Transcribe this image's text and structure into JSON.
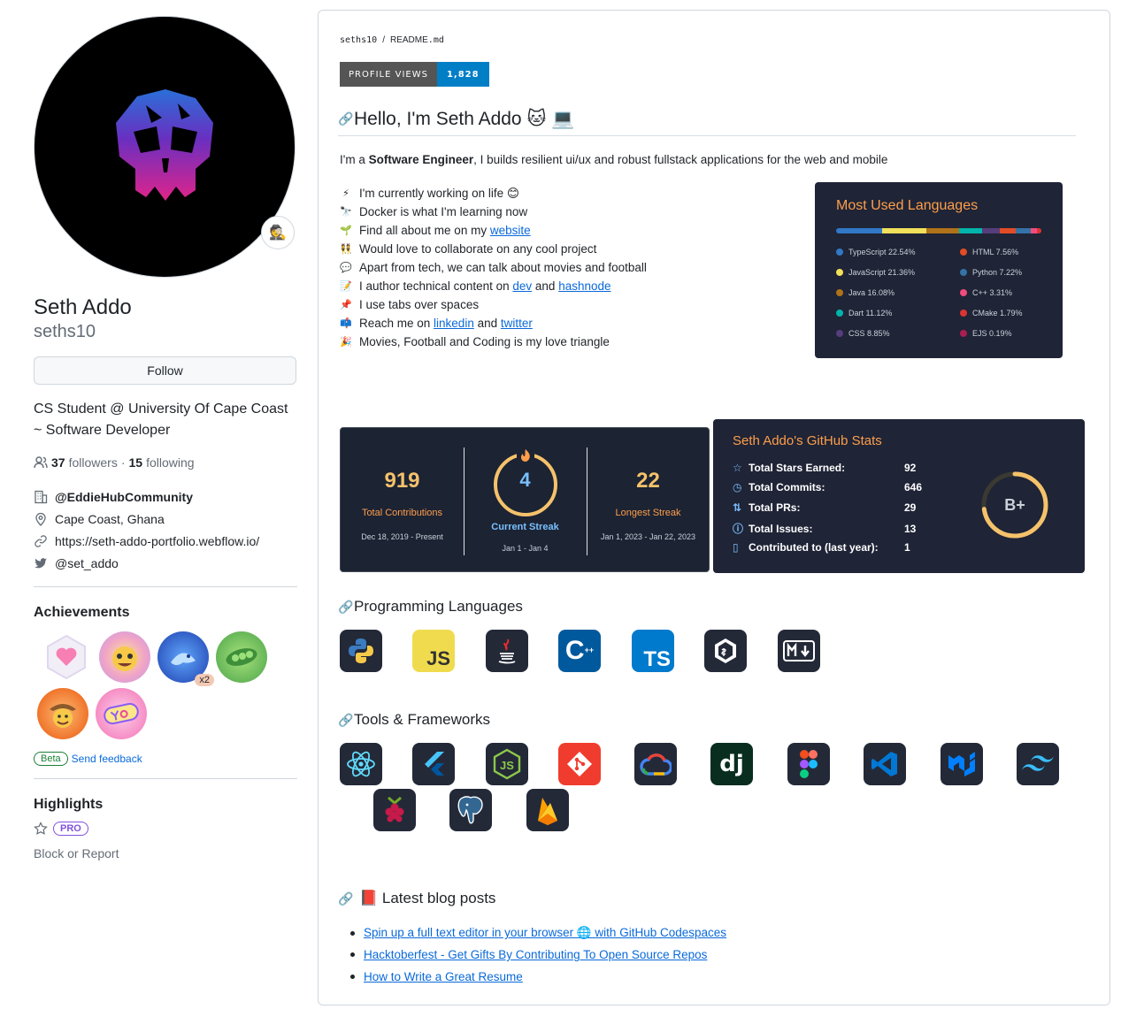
{
  "profile": {
    "fullname": "Seth Addo",
    "username": "seths10",
    "follow_label": "Follow",
    "bio": "CS Student @ University Of Cape Coast ~ Software Developer",
    "followers_count": "37",
    "followers_label": "followers",
    "dot": "·",
    "following_count": "15",
    "following_label": "following",
    "organization": "@EddieHubCommunity",
    "location": "Cape Coast, Ghana",
    "website": "https://seth-addo-portfolio.webflow.io/",
    "twitter": "@set_addo",
    "status_emoji": "🕵️"
  },
  "achievements": {
    "title": "Achievements",
    "badge_x2": "x2",
    "beta": "Beta",
    "feedback": "Send feedback"
  },
  "highlights": {
    "title": "Highlights",
    "pro": "PRO",
    "block": "Block or Report"
  },
  "readme": {
    "crumb_user": "seths10",
    "crumb_sep": "/",
    "crumb_file": "README",
    "crumb_ext": ".md",
    "views_label": "PROFILE VIEWS",
    "views_value": "1,828",
    "heading": "Hello, I'm Seth Addo 🐱 💻",
    "intro_pre": "I'm a ",
    "intro_bold": "Software Engineer",
    "intro_post": ", I builds resilient ui/ux and robust fullstack applications for the web and mobile",
    "facts": [
      {
        "icon": "⚡",
        "text": "I'm currently working on life 😊"
      },
      {
        "icon": "🔭",
        "text": "Docker is what I'm learning now"
      },
      {
        "icon": "🌱",
        "pre": "Find all about me on my ",
        "link": "website"
      },
      {
        "icon": "👯",
        "text": "Would love to collaborate on any cool project"
      },
      {
        "icon": "💬",
        "text": "Apart from tech, we can talk about movies and football"
      },
      {
        "icon": "📝",
        "pre": "I author technical content on ",
        "link": "dev",
        "mid": " and ",
        "link2": "hashnode"
      },
      {
        "icon": "📌",
        "text": "I use tabs over spaces"
      },
      {
        "icon": "📫",
        "pre": "Reach me on ",
        "link": "linkedin",
        "mid": " and ",
        "link2": "twitter"
      },
      {
        "icon": "🎉",
        "text": "Movies, Football and Coding is my love triangle"
      }
    ],
    "prog_heading": "Programming Languages",
    "tools_heading": "Tools & Frameworks",
    "blog_heading": "📕 Latest blog posts",
    "blog_posts": [
      {
        "a": "Spin up a full text editor in your browser 🌐 with GitHub Codespaces"
      },
      {
        "a": "Hacktoberfest - Get Gifts By Contributing To Open Source Repos"
      },
      {
        "a": "How to Write a Great Resume"
      }
    ]
  },
  "langs": {
    "title": "Most Used Languages",
    "items": [
      {
        "name": "TypeScript 22.54%",
        "color": "#3178c6"
      },
      {
        "name": "JavaScript 21.36%",
        "color": "#f1e05a"
      },
      {
        "name": "Java 16.08%",
        "color": "#b07219"
      },
      {
        "name": "Dart 11.12%",
        "color": "#00b4ab"
      },
      {
        "name": "CSS 8.85%",
        "color": "#563d7c"
      },
      {
        "name": "HTML 7.56%",
        "color": "#e34c26"
      },
      {
        "name": "Python 7.22%",
        "color": "#3572a5"
      },
      {
        "name": "C++ 3.31%",
        "color": "#f34b7d"
      },
      {
        "name": "CMake 1.79%",
        "color": "#da3434"
      },
      {
        "name": "EJS 0.19%",
        "color": "#a91e50"
      }
    ]
  },
  "streak": {
    "total": "919",
    "total_label": "Total Contributions",
    "total_range": "Dec 18, 2019 - Present",
    "current": "4",
    "current_label": "Current Streak",
    "current_range": "Jan 1 - Jan 4",
    "longest": "22",
    "longest_label": "Longest Streak",
    "longest_range": "Jan 1, 2023 - Jan 22, 2023"
  },
  "stats": {
    "title": "Seth Addo's GitHub Stats",
    "rows": [
      {
        "label": "Total Stars Earned:",
        "value": "92",
        "icon": "☆"
      },
      {
        "label": "Total Commits:",
        "value": "646",
        "icon": "◷"
      },
      {
        "label": "Total PRs:",
        "value": "29",
        "icon": "⇅"
      },
      {
        "label": "Total Issues:",
        "value": "13",
        "icon": "ⓘ"
      },
      {
        "label": "Contributed to (last year):",
        "value": "1",
        "icon": "▯"
      }
    ],
    "grade": "B+"
  },
  "prog_icons": [
    "python-icon",
    "javascript-icon",
    "java-icon",
    "cplusplus-icon",
    "typescript-icon",
    "bash-icon",
    "markdown-icon"
  ],
  "tool_icons": [
    "react-icon",
    "flutter-icon",
    "nodejs-icon",
    "git-icon",
    "gcp-icon",
    "django-icon",
    "figma-icon",
    "vscode-icon",
    "mui-icon",
    "tailwind-icon",
    "raspberrypi-icon",
    "postgresql-icon",
    "firebase-icon"
  ]
}
